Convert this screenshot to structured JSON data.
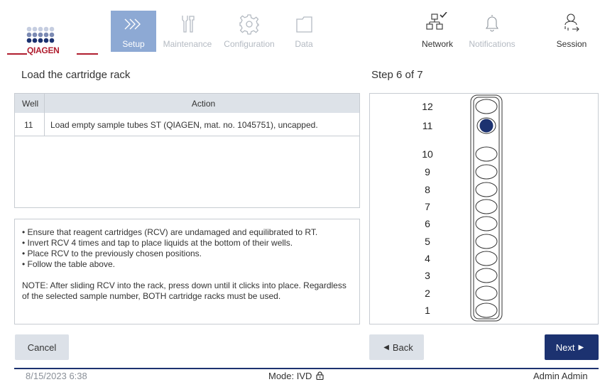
{
  "header": {
    "brand": "QIAGEN",
    "nav": [
      {
        "label": "Setup",
        "icon": "chevrons-right-icon",
        "active": true
      },
      {
        "label": "Maintenance",
        "icon": "tools-icon",
        "active": false
      },
      {
        "label": "Configuration",
        "icon": "gear-icon",
        "active": false
      },
      {
        "label": "Data",
        "icon": "folder-icon",
        "active": false
      }
    ],
    "right": [
      {
        "label": "Network",
        "icon": "network-icon"
      },
      {
        "label": "Notifications",
        "icon": "bell-icon"
      },
      {
        "label": "Session",
        "icon": "user-logout-icon"
      }
    ]
  },
  "page": {
    "title": "Load the cartridge rack",
    "step": "Step 6 of 7"
  },
  "table": {
    "headers": [
      "Well",
      "Action"
    ],
    "rows": [
      {
        "well": "11",
        "action": "Load empty sample tubes ST (QIAGEN, mat. no. 1045751), uncapped."
      }
    ]
  },
  "instructions": {
    "bullets": [
      "• Ensure that reagent cartridges (RCV) are undamaged and equilibrated to RT.",
      "• Invert RCV 4 times and tap to place liquids at the bottom of their wells.",
      "• Place RCV to the previously chosen positions.",
      "• Follow the table above."
    ],
    "note": "NOTE: After sliding RCV into the rack, press down until it clicks into place. Regardless of the selected sample number, BOTH cartridge racks must be used."
  },
  "rack": {
    "positions": [
      "12",
      "11",
      "10",
      "9",
      "8",
      "7",
      "6",
      "5",
      "4",
      "3",
      "2",
      "1"
    ],
    "highlighted": "11",
    "fill_color": "#1c3270"
  },
  "buttons": {
    "cancel": "Cancel",
    "back": "Back",
    "next": "Next"
  },
  "footer": {
    "datetime": "8/15/2023 6:38",
    "mode": "Mode: IVD",
    "user": "Admin Admin"
  },
  "colors": {
    "active_tab": "#8da9d4",
    "primary": "#1c3270",
    "brand_red": "#b01e2f"
  }
}
